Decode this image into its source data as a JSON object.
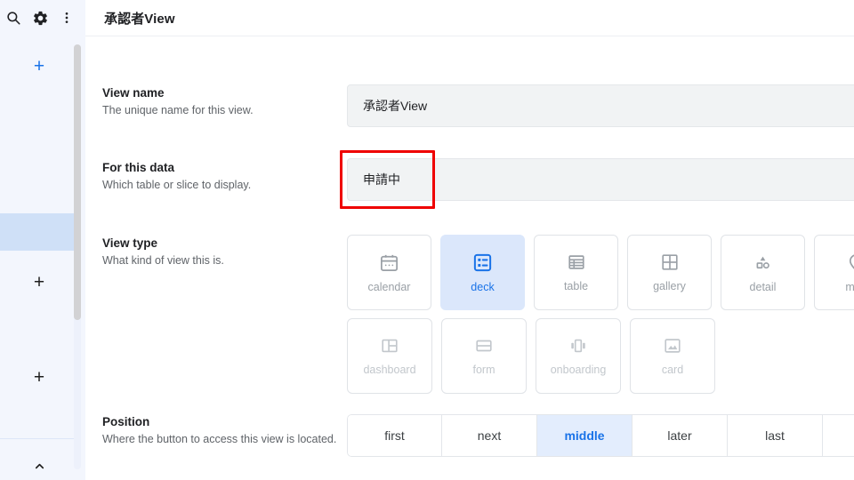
{
  "rail": {
    "search_icon": "search-icon",
    "settings_icon": "gear-icon",
    "more_icon": "more-vertical-icon",
    "add_top_label": "+",
    "add_mid_label": "+",
    "add_bottom_label": "+",
    "collapse_icon": "chevron-up-icon"
  },
  "header": {
    "title": "承認者View"
  },
  "form": {
    "view_name": {
      "label": "View name",
      "description": "The unique name for this view.",
      "value": "承認者View",
      "placeholder": "View name"
    },
    "for_this_data": {
      "label": "For this data",
      "description": "Which table or slice to display.",
      "value": "申請中",
      "highlight_color": "#ef0000"
    },
    "view_type": {
      "label": "View type",
      "description": "What kind of view this is.",
      "selected": "deck",
      "row1": [
        {
          "id": "calendar",
          "label": "calendar",
          "icon": "calendar-icon",
          "selected": false,
          "dim": false
        },
        {
          "id": "deck",
          "label": "deck",
          "icon": "deck-icon",
          "selected": true,
          "dim": false
        },
        {
          "id": "table",
          "label": "table",
          "icon": "table-icon",
          "selected": false,
          "dim": false
        },
        {
          "id": "gallery",
          "label": "gallery",
          "icon": "gallery-icon",
          "selected": false,
          "dim": false
        },
        {
          "id": "detail",
          "label": "detail",
          "icon": "detail-icon",
          "selected": false,
          "dim": false
        },
        {
          "id": "map",
          "label": "map",
          "icon": "map-pin-icon",
          "selected": false,
          "dim": false
        }
      ],
      "row2": [
        {
          "id": "dashboard",
          "label": "dashboard",
          "icon": "dashboard-icon",
          "selected": false,
          "dim": true
        },
        {
          "id": "form",
          "label": "form",
          "icon": "form-icon",
          "selected": false,
          "dim": true
        },
        {
          "id": "onboarding",
          "label": "onboarding",
          "icon": "onboarding-icon",
          "selected": false,
          "dim": true
        },
        {
          "id": "card",
          "label": "card",
          "icon": "card-icon",
          "selected": false,
          "dim": true
        }
      ]
    },
    "position": {
      "label": "Position",
      "description": "Where the button to access this view is located.",
      "selected": "middle",
      "options": [
        {
          "id": "first",
          "label": "first",
          "selected": false
        },
        {
          "id": "next",
          "label": "next",
          "selected": false
        },
        {
          "id": "middle",
          "label": "middle",
          "selected": true
        },
        {
          "id": "later",
          "label": "later",
          "selected": false
        },
        {
          "id": "last",
          "label": "last",
          "selected": false
        },
        {
          "id": "more",
          "label": "",
          "selected": false
        }
      ]
    }
  },
  "colors": {
    "accent": "#1a73e8",
    "selected_bg": "#dbe7fb",
    "rail_bg": "#f3f6fd",
    "field_bg": "#f1f3f4"
  }
}
